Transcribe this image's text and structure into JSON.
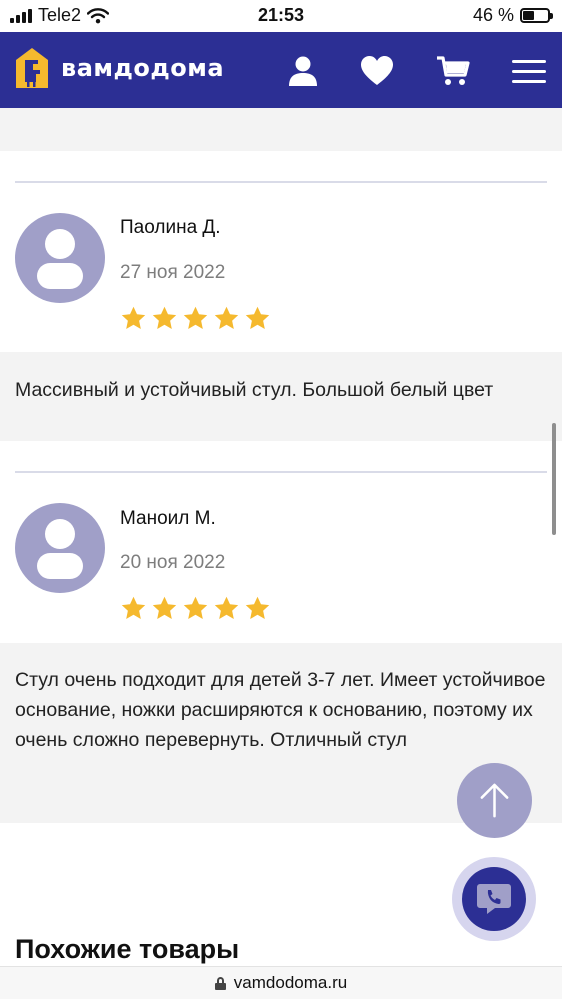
{
  "status_bar": {
    "carrier": "Tele2",
    "time": "21:53",
    "battery": "46 %",
    "battery_level": 0.46
  },
  "header": {
    "brand": "вамдодома",
    "icons": [
      "user-icon",
      "heart-icon",
      "cart-icon",
      "menu-icon"
    ],
    "brand_color": "#2c2f94"
  },
  "reviews": [
    {
      "author": "Паолина Д.",
      "date": "27 ноя 2022",
      "rating": 5,
      "text": "Массивный и устойчивый стул. Большой белый цвет"
    },
    {
      "author": "Маноил М.",
      "date": "20 ноя 2022",
      "rating": 5,
      "text": "Стул очень подходит для детей 3-7 лет. Имеет устойчивое основание, ножки расширяются к основанию, поэтому их очень сложно перевернуть. Отличный стул"
    }
  ],
  "similar": {
    "title": "Похожие товары"
  },
  "browser": {
    "url": "vamdodoma.ru"
  },
  "colors": {
    "star": "#f5b92e",
    "avatar": "#a09fc8",
    "accent": "#2c2f94"
  }
}
